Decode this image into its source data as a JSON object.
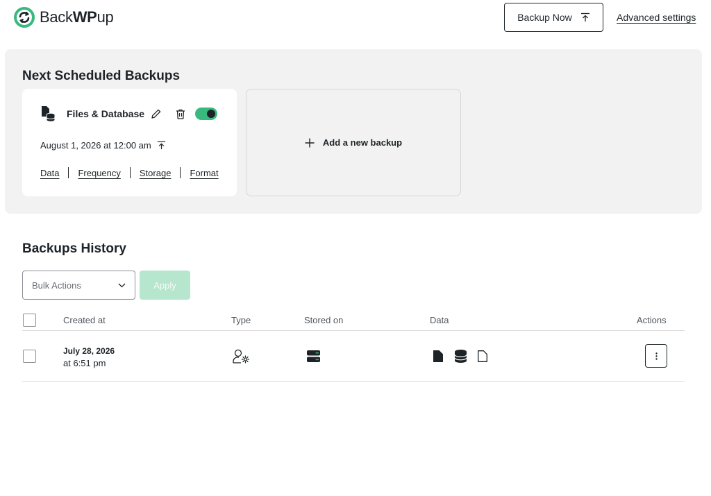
{
  "header": {
    "logo_text_bold": "Back",
    "logo_text_wp": "WP",
    "logo_text_light": "up",
    "backup_now_label": "Backup Now",
    "advanced_settings_label": "Advanced settings"
  },
  "scheduled": {
    "title": "Next Scheduled Backups",
    "card": {
      "title": "Files & Database",
      "enabled": true,
      "date": "August 1, 2026 at 12:00 am",
      "links": [
        "Data",
        "Frequency",
        "Storage",
        "Format"
      ]
    },
    "add_new_label": "Add a new backup"
  },
  "history": {
    "title": "Backups History",
    "bulk_actions_label": "Bulk Actions",
    "apply_label": "Apply",
    "columns": {
      "created_at": "Created at",
      "type": "Type",
      "stored_on": "Stored on",
      "data": "Data",
      "actions": "Actions"
    },
    "rows": [
      {
        "date": "July 28, 2026",
        "time": "at 6:51 pm",
        "type_icon": "user-gear-icon",
        "storage_icon": "server-icon",
        "data_icons": [
          "file-icon",
          "database-icon",
          "file-outline-icon"
        ]
      }
    ]
  },
  "colors": {
    "accent": "#3ab97f",
    "apply_disabled": "#b6e6cd",
    "panel_bg": "#f2f2f2",
    "text": "#1d2327"
  }
}
